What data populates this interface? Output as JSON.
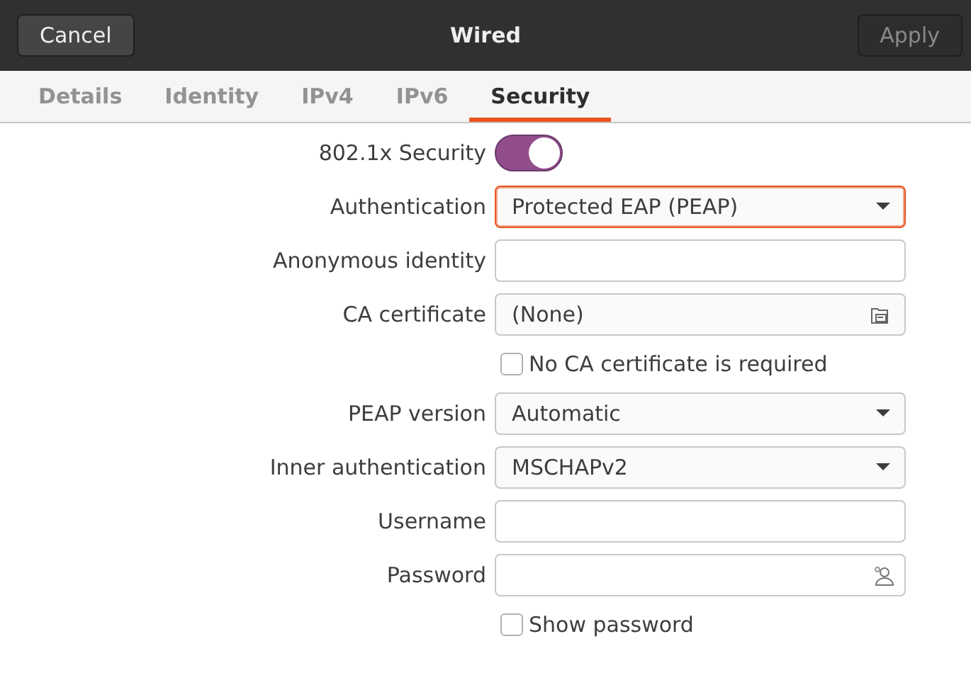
{
  "header": {
    "cancel": "Cancel",
    "title": "Wired",
    "apply": {
      "label": "Apply",
      "disabled": true
    }
  },
  "tabs": [
    {
      "label": "Details",
      "selected": false
    },
    {
      "label": "Identity",
      "selected": false
    },
    {
      "label": "IPv4",
      "selected": false
    },
    {
      "label": "IPv6",
      "selected": false
    },
    {
      "label": "Security",
      "selected": true
    }
  ],
  "rows": [
    {
      "kind": "switch",
      "label": "802.1x Security",
      "on": true
    },
    {
      "kind": "combo",
      "label": "Authentication",
      "value": "Protected EAP (PEAP)",
      "focused": true
    },
    {
      "kind": "entry",
      "label": "Anonymous identity"
    },
    {
      "kind": "file",
      "label": "CA certificate",
      "value": "(None)"
    },
    {
      "kind": "checkbox",
      "label": "No CA certificate is required",
      "checked": false
    },
    {
      "kind": "combo",
      "label": "PEAP version",
      "value": "Automatic",
      "focused": false
    },
    {
      "kind": "combo",
      "label": "Inner authentication",
      "value": "MSCHAPv2",
      "focused": false
    },
    {
      "kind": "entry",
      "label": "Username"
    },
    {
      "kind": "password",
      "label": "Password"
    },
    {
      "kind": "checkbox",
      "label": "Show password",
      "checked": false
    }
  ]
}
